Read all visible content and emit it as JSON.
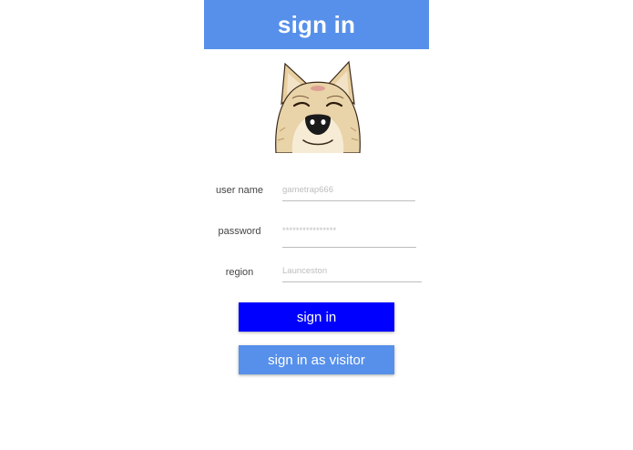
{
  "header": {
    "title": "sign in",
    "color": "#5790ea"
  },
  "avatar": {
    "icon": "dog-face-icon"
  },
  "form": {
    "username": {
      "label": "user name",
      "value": "gametrap666"
    },
    "password": {
      "label": "password",
      "value": "****************"
    },
    "region": {
      "label": "region",
      "value": "Launceston"
    }
  },
  "buttons": {
    "sign_in_label": "sign in",
    "sign_in_color": "#0000ff",
    "visitor_label": "sign in as visitor",
    "visitor_color": "#5790ea"
  }
}
